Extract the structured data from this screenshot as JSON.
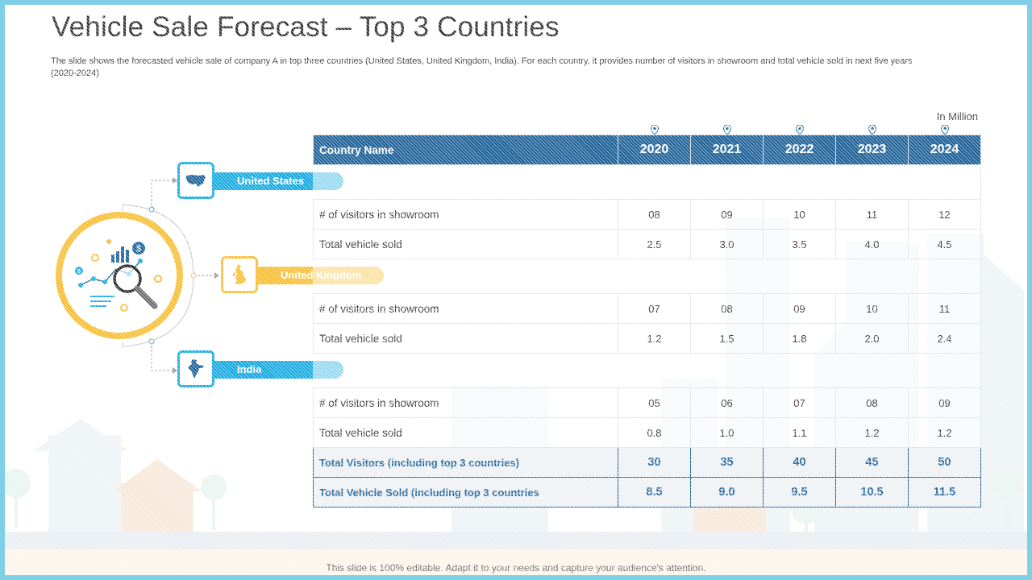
{
  "title": "Vehicle Sale Forecast – Top 3 Countries",
  "subtitle": "The slide shows the forecasted vehicle sale of company A in top three countries (United States, United Kingdom, India). For each country, it provides number of visitors in showroom and total vehicle sold in next five years (2020-2024)",
  "unit_note": "In Million",
  "table": {
    "header_label": "Country Name",
    "years": [
      "2020",
      "2021",
      "2022",
      "2023",
      "2024"
    ],
    "sections": [
      {
        "country": "United States",
        "rows": [
          {
            "label": "# of visitors in showroom",
            "values": [
              "08",
              "09",
              "10",
              "11",
              "12"
            ]
          },
          {
            "label": "Total vehicle sold",
            "values": [
              "2.5",
              "3.0",
              "3.5",
              "4.0",
              "4.5"
            ]
          }
        ]
      },
      {
        "country": "United Kingdom",
        "rows": [
          {
            "label": "# of visitors in showroom",
            "values": [
              "07",
              "08",
              "09",
              "10",
              "11"
            ]
          },
          {
            "label": "Total vehicle sold",
            "values": [
              "1.2",
              "1.5",
              "1.8",
              "2.0",
              "2.4"
            ]
          }
        ]
      },
      {
        "country": "India",
        "rows": [
          {
            "label": "# of visitors in showroom",
            "values": [
              "05",
              "06",
              "07",
              "08",
              "09"
            ]
          },
          {
            "label": "Total vehicle sold",
            "values": [
              "0.8",
              "1.0",
              "1.1",
              "1.2",
              "1.2"
            ]
          }
        ]
      }
    ],
    "totals": [
      {
        "label": "Total Visitors (including top 3 countries)",
        "values": [
          "30",
          "35",
          "40",
          "45",
          "50"
        ]
      },
      {
        "label": "Total Vehicle Sold (including top 3 countries",
        "values": [
          "8.5",
          "9.0",
          "9.5",
          "10.5",
          "11.5"
        ]
      }
    ]
  },
  "countries": {
    "us": {
      "label": "United States",
      "color": "#12a8e0",
      "icon": "usa-map-icon"
    },
    "uk": {
      "label": "United Kingdom",
      "color": "#f8bd30",
      "icon": "uk-map-icon"
    },
    "india": {
      "label": "India",
      "color": "#12a8e0",
      "icon": "india-map-icon"
    }
  },
  "center_icon": "analytics-magnifier-icon",
  "colors": {
    "header": "#1b5f96",
    "accent_blue": "#12a8e0",
    "accent_yellow": "#f8bd30"
  },
  "footer": "This slide is 100% editable. Adapt it to your needs and capture your audience's attention."
}
